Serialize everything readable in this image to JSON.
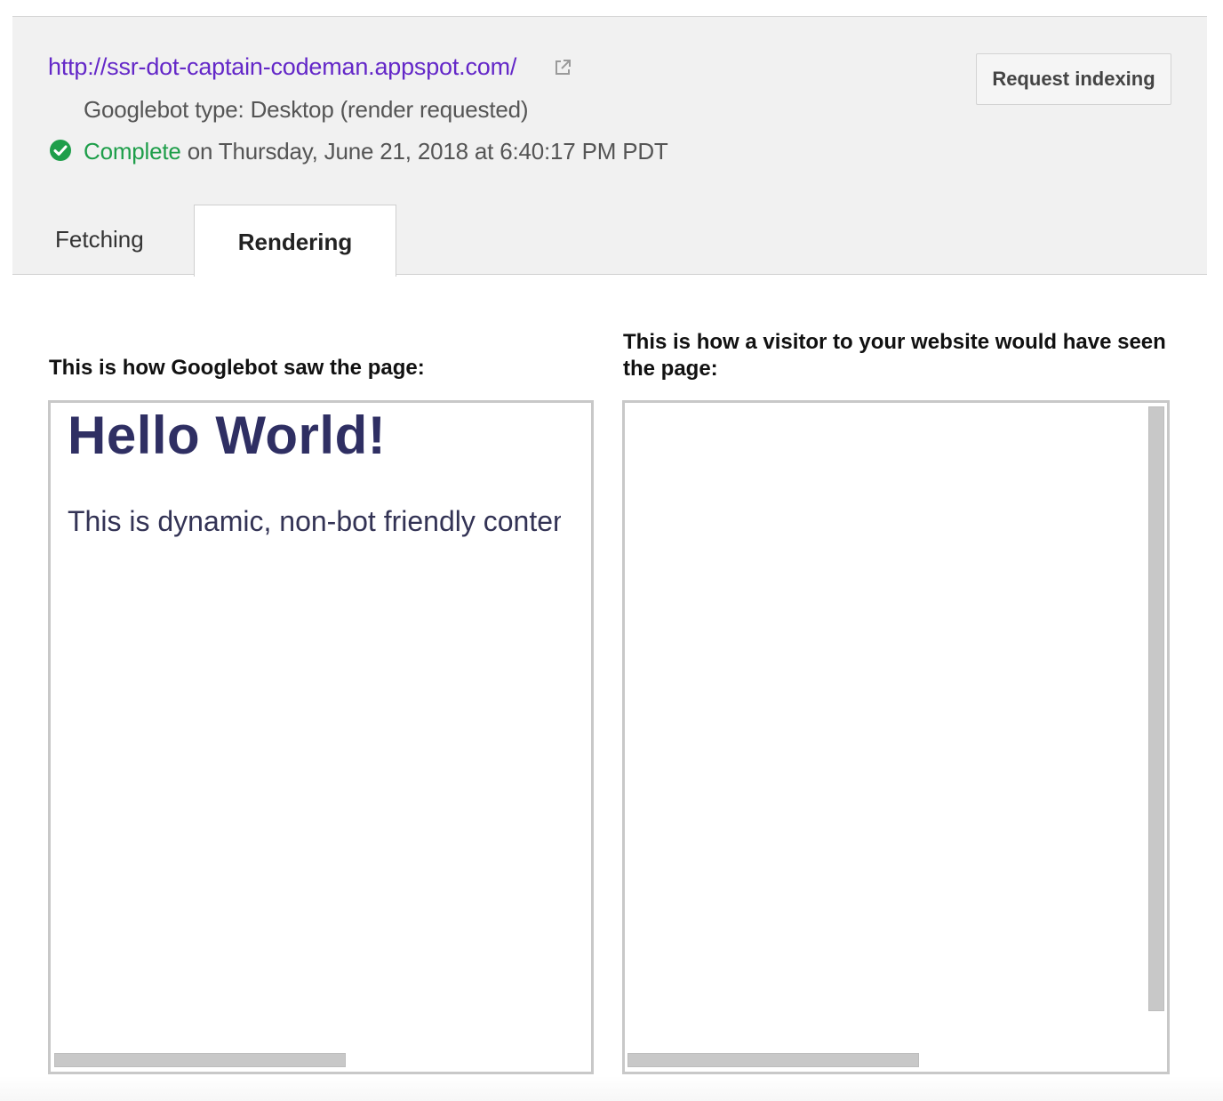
{
  "header": {
    "url": "http://ssr-dot-captain-codeman.appspot.com/",
    "external_link_icon": "external-link-icon",
    "googlebot_type": "Googlebot type: Desktop (render requested)",
    "status_icon": "check-circle-icon",
    "status_word": "Complete",
    "status_detail": " on Thursday, June 21, 2018 at 6:40:17 PM PDT",
    "request_button_label": "Request indexing"
  },
  "tabs": [
    {
      "label": "Fetching",
      "active": false
    },
    {
      "label": "Rendering",
      "active": true
    }
  ],
  "comparison": {
    "left_caption": "This is how Googlebot saw the page:",
    "right_caption": "This is how a visitor to your website would have seen the page:",
    "left_render": {
      "heading": "Hello World!",
      "body_text": "This is dynamic, non-bot friendly conten"
    }
  },
  "colors": {
    "link": "#6428c8",
    "complete": "#1e9e4a",
    "heading": "#2f2f63"
  }
}
